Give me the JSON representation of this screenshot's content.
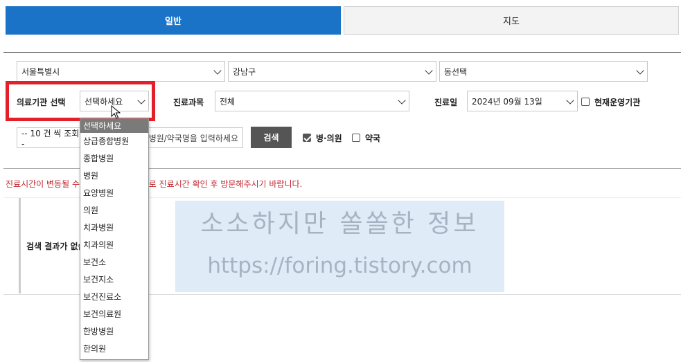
{
  "tabs": [
    {
      "label": "일반",
      "active": true
    },
    {
      "label": "지도",
      "active": false
    }
  ],
  "filters": {
    "city": "서울특별시",
    "district": "강남구",
    "dong": "동선택",
    "institution_label": "의료기관 선택",
    "institution_value": "선택하세요",
    "department_label": "진료과목",
    "department_value": "전체",
    "date_label": "진료일",
    "date_value": "2024년 09월 13일",
    "operating_label": "현재운영기관",
    "page_size": "-- 10 건 씩 조회 --",
    "name_placeholder": "병원/약국명을 입력하세요",
    "search_label": "검색",
    "clinic_label": "병·의원",
    "clinic_checked": true,
    "pharmacy_label": "약국",
    "pharmacy_checked": false
  },
  "notice": "진료시간이 변동될 수 있으니 반드시 전화로 진료시간 확인 후 방문해주시기 바랍니다.",
  "result_text": "검색 결과가 없습니다.",
  "watermark": {
    "line1": "소소하지만 쏠쏠한 정보",
    "line2": "https://foring.tistory.com"
  },
  "dropdown_options": [
    "선택하세요",
    "상급종합병원",
    "종합병원",
    "병원",
    "요양병원",
    "의원",
    "치과병원",
    "치과의원",
    "보건소",
    "보건지소",
    "보건진료소",
    "보건의료원",
    "한방병원",
    "한의원"
  ],
  "colors": {
    "accent_tab": "#1a73c7",
    "highlight": "#e3202a",
    "notice": "#c0262d"
  }
}
